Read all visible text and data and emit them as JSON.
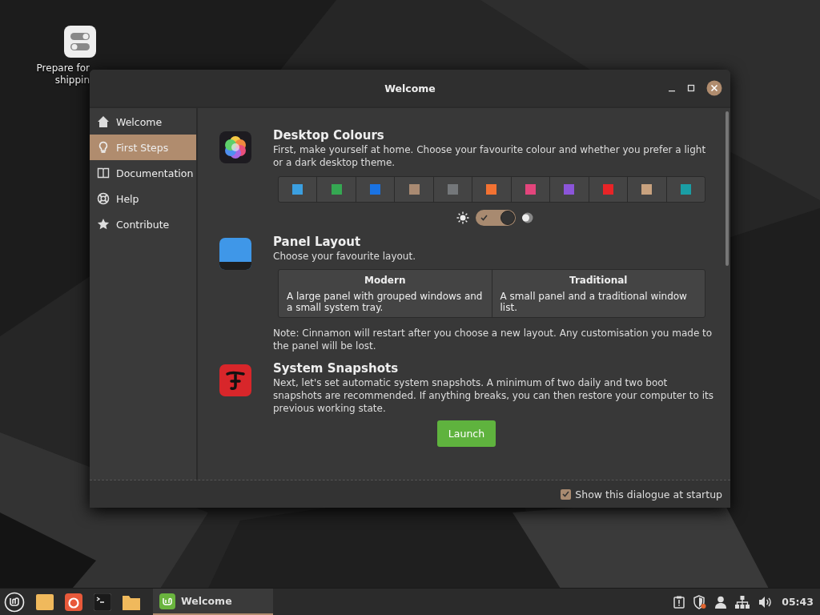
{
  "desktop_icons": [
    {
      "label_lines": [
        "Prepare for",
        "shippin"
      ]
    }
  ],
  "window": {
    "title": "Welcome"
  },
  "sidebar": {
    "items": [
      {
        "label": "Welcome",
        "selected": false
      },
      {
        "label": "First Steps",
        "selected": true
      },
      {
        "label": "Documentation",
        "selected": false
      },
      {
        "label": "Help",
        "selected": false
      },
      {
        "label": "Contribute",
        "selected": false
      }
    ]
  },
  "sections": [
    {
      "kind": "colours",
      "title": "Desktop Colours",
      "text": "First, make yourself at home. Choose your favourite colour and whether you prefer a light or a dark desktop theme.",
      "colours": [
        {
          "color": "#3b9fe0"
        },
        {
          "color": "#35a852"
        },
        {
          "color": "#1a73e3"
        },
        {
          "color": "#a98a72"
        },
        {
          "color": "#74777a"
        },
        {
          "color": "#f37232"
        },
        {
          "color": "#e3457c"
        },
        {
          "color": "#8b55d9"
        },
        {
          "color": "#e82427"
        },
        {
          "color": "#c8a27f"
        },
        {
          "color": "#1a9ea5"
        }
      ],
      "dark_mode": {
        "on": true
      }
    },
    {
      "kind": "layout",
      "title": "Panel Layout",
      "text": "Choose your favourite layout.",
      "options": [
        {
          "title": "Modern",
          "text": "A large panel with grouped windows and a small system tray."
        },
        {
          "title": "Traditional",
          "text": "A small panel and a traditional window list."
        }
      ],
      "note": "Note: Cinnamon will restart after you choose a new layout. Any customisation you made to the panel will be lost."
    },
    {
      "kind": "snapshots",
      "title": "System Snapshots",
      "text": "Next, let's set automatic system snapshots. A minimum of two daily and two boot snapshots are recommended. If anything breaks, you can then restore your computer to its previous working state.",
      "button": "Launch"
    }
  ],
  "footer": {
    "checkbox": {
      "label": "Show this dialogue at startup",
      "checked": true
    }
  },
  "taskbar": {
    "windows": [
      {
        "label": "Welcome"
      }
    ],
    "clock": "05:43"
  }
}
